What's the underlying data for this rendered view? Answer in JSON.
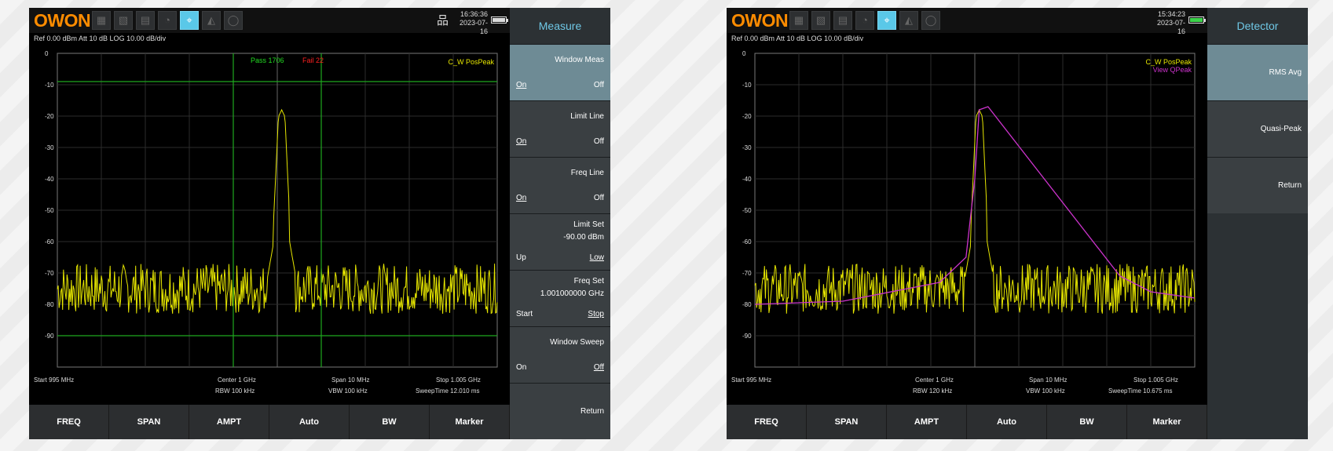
{
  "left": {
    "logo": "OWON",
    "clock": {
      "time": "16:36:36",
      "date": "2023-07-16"
    },
    "ref_line": "Ref 0.00 dBm  Att 10 dB  LOG 10.00 dB/div",
    "trace_label": "C_W PosPeak",
    "pass_label": "Pass 1706",
    "fail_label": "Fail 22",
    "y_labels": [
      "0",
      "-10",
      "-20",
      "-30",
      "-40",
      "-50",
      "-60",
      "-70",
      "-80",
      "-90"
    ],
    "footer": {
      "start": "Start 995 MHz",
      "center": "Center 1 GHz",
      "span": "Span 10 MHz",
      "stop": "Stop 1.005 GHz",
      "rbw": "RBW 100 kHz",
      "vbw": "VBW 100 kHz",
      "sweep": "SweepTime 12.010 ms"
    },
    "bottom_buttons": [
      "FREQ",
      "SPAN",
      "AMPT",
      "Auto",
      "BW",
      "Marker"
    ],
    "side": {
      "title": "Measure",
      "window_meas": {
        "label": "Window Meas",
        "on": "On",
        "off": "Off"
      },
      "limit_line": {
        "label": "Limit Line",
        "on": "On",
        "off": "Off"
      },
      "freq_line": {
        "label": "Freq Line",
        "on": "On",
        "off": "Off"
      },
      "limit_set": {
        "label": "Limit Set",
        "value": "-90.00 dBm",
        "up": "Up",
        "low": "Low"
      },
      "freq_set": {
        "label": "Freq Set",
        "value": "1.001000000 GHz",
        "start": "Start",
        "stop": "Stop"
      },
      "window_sweep": {
        "label": "Window Sweep",
        "on": "On",
        "off": "Off"
      },
      "return": "Return"
    }
  },
  "right": {
    "logo": "OWON",
    "clock": {
      "time": "15:34:23",
      "date": "2023-07-16"
    },
    "ref_line": "Ref 0.00 dBm  Att 10 dB  LOG 10.00 dB/div",
    "trace_label": "C_W PosPeak",
    "trace_label2": "View QPeak",
    "y_labels": [
      "0",
      "-10",
      "-20",
      "-30",
      "-40",
      "-50",
      "-60",
      "-70",
      "-80",
      "-90"
    ],
    "footer": {
      "start": "Start 995 MHz",
      "center": "Center 1 GHz",
      "span": "Span 10 MHz",
      "stop": "Stop 1.005 GHz",
      "rbw": "RBW 120 kHz",
      "vbw": "VBW 100 kHz",
      "sweep": "SweepTime 10.675 ms"
    },
    "bottom_buttons": [
      "FREQ",
      "SPAN",
      "AMPT",
      "Auto",
      "BW",
      "Marker"
    ],
    "side": {
      "title": "Detector",
      "rms_avg": "RMS Avg",
      "quasi_peak": "Quasi-Peak",
      "return": "Return"
    }
  },
  "colors": {
    "trace": "#e6e600",
    "limit": "#1fa81f",
    "qpeak": "#cc33cc",
    "pass": "#22dd22",
    "fail": "#ff2020",
    "accent": "#6fc8e6"
  }
}
